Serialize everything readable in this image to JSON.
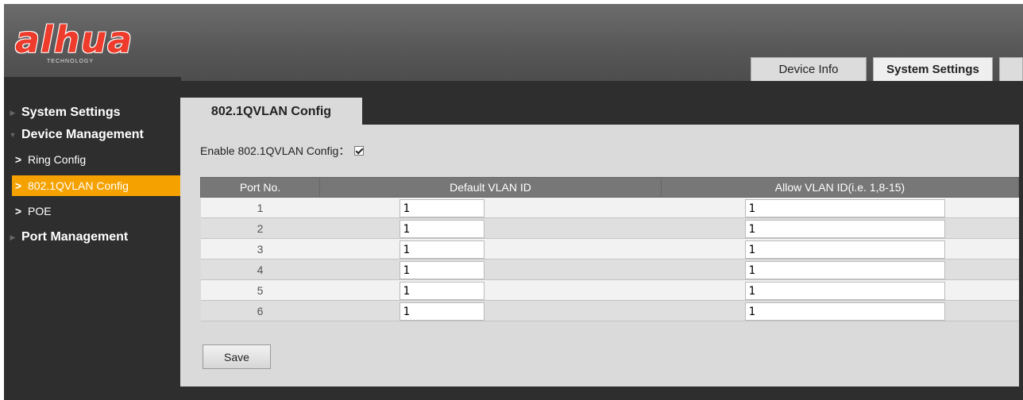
{
  "brand": {
    "logo_text": "alhua",
    "logo_sub": "TECHNOLOGY",
    "logo_color": "#ee3b2b"
  },
  "top_tabs": [
    {
      "label": "Device Info"
    },
    {
      "label": "System Settings",
      "active": true
    },
    {
      "label": ""
    }
  ],
  "sidebar": {
    "items": [
      {
        "label": "System Settings",
        "level": 1,
        "icon": "triangle-right-icon"
      },
      {
        "label": "Device Management",
        "level": 1,
        "icon": "triangle-down-icon",
        "expanded": true
      },
      {
        "label": "Ring Config",
        "level": 2,
        "icon": "chevron-right-icon"
      },
      {
        "label": "802.1QVLAN Config",
        "level": 2,
        "icon": "chevron-right-icon",
        "active": true
      },
      {
        "label": "POE",
        "level": 2,
        "icon": "chevron-right-icon"
      },
      {
        "label": "Port Management",
        "level": 1,
        "icon": "triangle-right-icon"
      }
    ],
    "active_color": "#f5a200"
  },
  "content": {
    "tab_label": "802.1QVLAN Config",
    "enable_label": "Enable 802.1QVLAN Config：",
    "enable_checked": true,
    "table": {
      "headers": [
        "Port No.",
        "Default VLAN ID",
        "Allow VLAN ID(i.e. 1,8-15)"
      ],
      "rows": [
        {
          "port": "1",
          "default_vlan": "1",
          "allow_vlan": "1"
        },
        {
          "port": "2",
          "default_vlan": "1",
          "allow_vlan": "1"
        },
        {
          "port": "3",
          "default_vlan": "1",
          "allow_vlan": "1"
        },
        {
          "port": "4",
          "default_vlan": "1",
          "allow_vlan": "1"
        },
        {
          "port": "5",
          "default_vlan": "1",
          "allow_vlan": "1"
        },
        {
          "port": "6",
          "default_vlan": "1",
          "allow_vlan": "1"
        }
      ]
    },
    "save_label": "Save"
  }
}
